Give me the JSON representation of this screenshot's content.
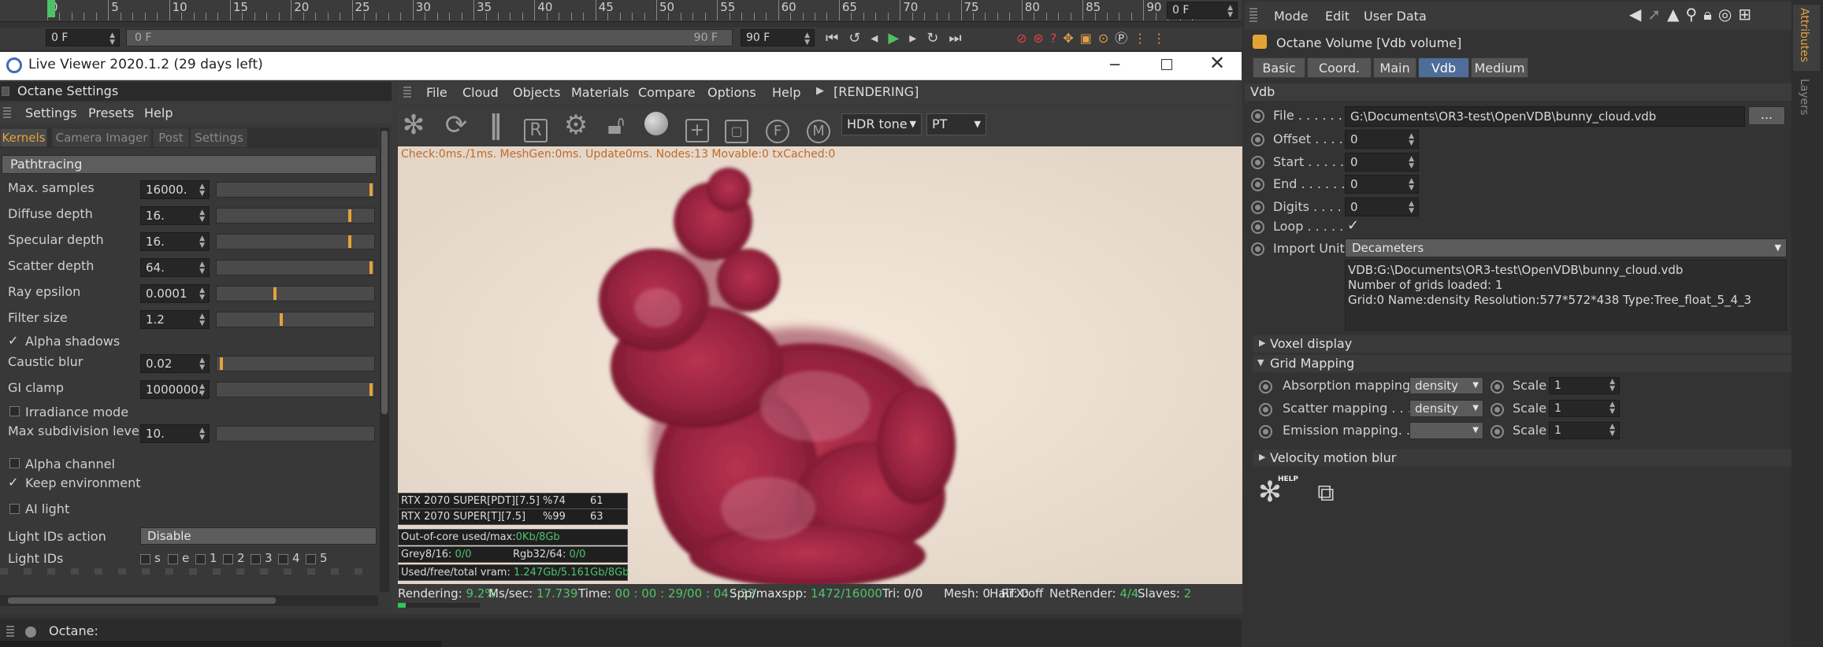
{
  "timeline": {
    "ticks": [
      "0",
      "5",
      "10",
      "15",
      "20",
      "25",
      "30",
      "35",
      "40",
      "45",
      "50",
      "55",
      "60",
      "65",
      "70",
      "75",
      "80",
      "85",
      "90"
    ],
    "frame_field": "0 F",
    "start_field": "0 F",
    "range_field": "0 F",
    "range_end": "90 F",
    "end_field": "90 F"
  },
  "window": {
    "title": "Live Viewer 2020.1.2 (29 days left)"
  },
  "settings_panel": {
    "title": "Octane Settings",
    "menu": [
      "Settings",
      "Presets",
      "Help"
    ],
    "tabs": [
      "Kernels",
      "Camera Imager",
      "Post",
      "Settings"
    ],
    "kernel_dropdown": "Pathtracing",
    "params": [
      {
        "label": "Max. samples",
        "value": "16000.",
        "fill": 1
      },
      {
        "label": "Diffuse depth",
        "value": "16.",
        "fill": 0.86
      },
      {
        "label": "Specular depth",
        "value": "16.",
        "fill": 0.86
      },
      {
        "label": "Scatter depth",
        "value": "64.",
        "fill": 1
      },
      {
        "label": "Ray epsilon",
        "value": "0.0001",
        "fill": 0.37
      },
      {
        "label": "Filter size",
        "value": "1.2",
        "fill": 0.41
      }
    ],
    "alpha_shadows": "Alpha shadows",
    "alpha_shadows_checkmark": "✓",
    "params2": [
      {
        "label": "Caustic blur",
        "value": "0.02",
        "fill": 0.02
      },
      {
        "label": "GI clamp",
        "value": "1000000.",
        "fill": 1
      }
    ],
    "irradiance_mode": "Irradiance mode",
    "max_subdiv_label": "Max subdivision level",
    "max_subdiv_value": "10.",
    "alpha_channel": "Alpha channel",
    "keep_environment": "Keep environment",
    "keep_environment_checkmark": "✓",
    "ai_light": "AI light",
    "light_ids_action_label": "Light IDs action",
    "light_ids_action_value": "Disable",
    "light_ids_label": "Light IDs",
    "light_ids": [
      "s",
      "e",
      "1",
      "2",
      "3",
      "4",
      "5"
    ]
  },
  "viewer": {
    "menu": [
      "File",
      "Cloud",
      "Objects",
      "Materials",
      "Compare",
      "Options",
      "Help"
    ],
    "status_tag": "[RENDERING]",
    "tone_dropdown": "HDR tone",
    "kernel_dropdown": "PT",
    "info_line": "Check:0ms./1ms. MeshGen:0ms. Update0ms. Nodes:13 Movable:0 txCached:0",
    "gpu_rows": [
      {
        "name": "RTX 2070 SUPER[PDT][7.5]",
        "pct": "%74",
        "temp": "61"
      },
      {
        "name": "RTX 2070 SUPER[T][7.5]",
        "pct": "%99",
        "temp": "63"
      }
    ],
    "ooc_label": "Out-of-core used/max:",
    "ooc_value": "0Kb/8Gb",
    "grey_label": "Grey8/16:",
    "grey_value": "0/0",
    "rgb_label": "Rgb32/64:",
    "rgb_value": "0/0",
    "vram_label": "Used/free/total vram:",
    "vram_value": "1.247Gb/5.161Gb/8Gb",
    "status": {
      "rendering_label": "Rendering:",
      "rendering_value": "9.2%",
      "progress": 0.092,
      "mssec_label": "Ms/sec:",
      "mssec_value": "17.739",
      "time_label": "Time:",
      "time_value": "00 : 00 : 29/00 : 04 : 33",
      "spp_label": "Spp/maxspp:",
      "spp_value": "1472/16000",
      "tri": "Tri: 0/0",
      "mesh": "Mesh: 0",
      "hair": "Hair: 0",
      "rtx": "RTX:off",
      "netrender_label": "NetRender:",
      "netrender_value": "4/4",
      "slaves_label": "Slaves:",
      "slaves_value": "2"
    }
  },
  "attributes": {
    "menu": [
      "Mode",
      "Edit",
      "User Data"
    ],
    "object_title": "Octane Volume [Vdb volume]",
    "tabs": [
      "Basic",
      "Coord.",
      "Main",
      "Vdb",
      "Medium"
    ],
    "section": "Vdb",
    "file_label": "File . . . . . .",
    "file_value": "G:\\Documents\\OR3-test\\OpenVDB\\bunny_cloud.vdb",
    "browse": "...",
    "fields": [
      {
        "label": "Offset . . . .",
        "value": "0"
      },
      {
        "label": "Start . . . . .",
        "value": "0"
      },
      {
        "label": "End . . . . . .",
        "value": "0"
      },
      {
        "label": "Digits . . . .",
        "value": "0"
      }
    ],
    "loop_label": "Loop . . . . .",
    "loop_checkmark": "✓",
    "import_label": "Import Unit",
    "import_value": "Decameters",
    "info": [
      "VDB:G:\\Documents\\OR3-test\\OpenVDB\\bunny_cloud.vdb",
      "Number of grids loaded: 1",
      "Grid:0  Name:density  Resolution:577*572*438  Type:Tree_float_5_4_3"
    ],
    "voxel_display": "Voxel display",
    "grid_mapping": "Grid Mapping",
    "mappings": [
      {
        "label": "Absorption mapping",
        "value": "density",
        "scale_label": "Scale",
        "scale": "1"
      },
      {
        "label": "Scatter mapping . . .",
        "value": "density",
        "scale_label": "Scale",
        "scale": "1"
      },
      {
        "label": "Emission mapping. .",
        "value": "",
        "scale_label": "Scale",
        "scale": "1"
      }
    ],
    "velocity_blur": "Velocity motion blur",
    "help_badge": "HELP",
    "side_tabs": [
      "Attributes",
      "Layers"
    ]
  },
  "console": {
    "label": "Octane:"
  }
}
